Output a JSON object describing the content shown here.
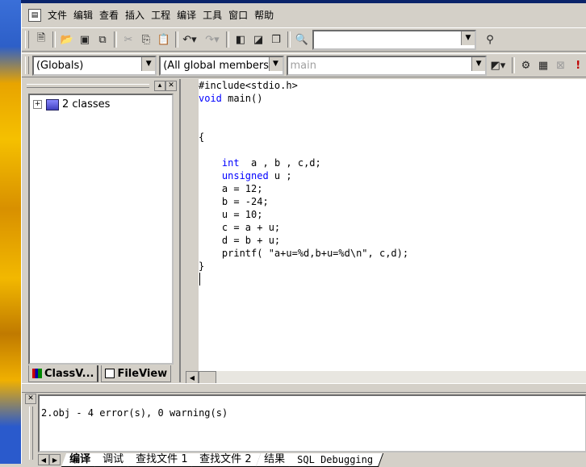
{
  "menu": {
    "items": [
      "文件",
      "编辑",
      "查看",
      "插入",
      "工程",
      "编译",
      "工具",
      "窗口",
      "帮助"
    ]
  },
  "toolbar1": {
    "find_combo_value": ""
  },
  "toolbar2": {
    "scope_combo": "(Globals)",
    "members_combo": "(All global members",
    "function_combo": "main"
  },
  "workspace": {
    "tree_root_label": "2 classes",
    "tabs": [
      "ClassV...",
      "FileView"
    ]
  },
  "editor": {
    "lines": [
      "#include<stdio.h>",
      "void main()",
      "",
      "",
      "{",
      "",
      "    int  a , b , c,d;",
      "    unsigned u ;",
      "    a = 12;",
      "    b = -24;",
      "    u = 10;",
      "    c = a + u;",
      "    d = b + u;",
      "    printf( \"a+u=%d,b+u=%d\\n\", c,d);",
      "}"
    ]
  },
  "output": {
    "message": "2.obj - 4 error(s), 0 warning(s)",
    "tabs": [
      "编译",
      "调试",
      "查找文件 1",
      "查找文件 2",
      "结果",
      "SQL Debugging"
    ]
  },
  "colors": {
    "chrome": "#d4d0c8",
    "keyword": "#0000ff",
    "titlebar": "#0a246a"
  }
}
